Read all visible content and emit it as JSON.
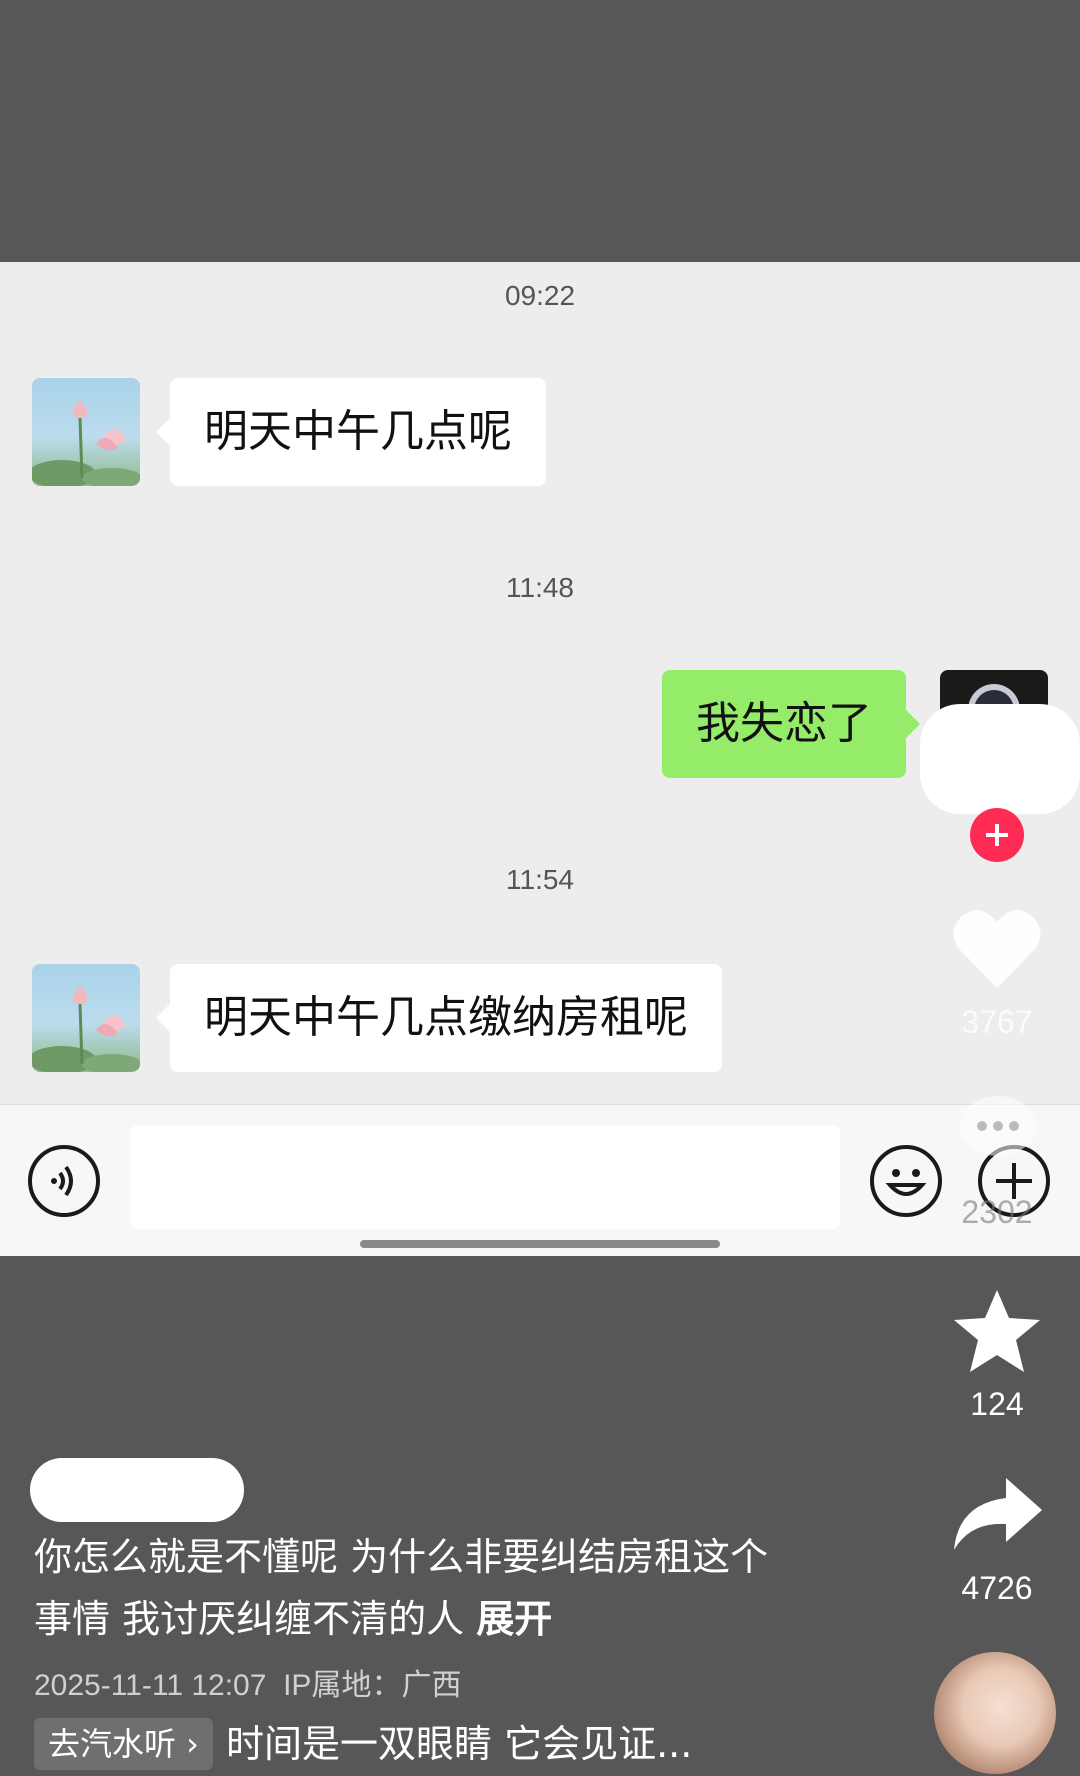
{
  "chat": {
    "timestamps": [
      "09:22",
      "11:48",
      "11:54"
    ],
    "messages": [
      {
        "side": "left",
        "text": "明天中午几点呢"
      },
      {
        "side": "right",
        "text": "我失恋了"
      },
      {
        "side": "left",
        "text": "明天中午几点缴纳房租呢"
      }
    ],
    "input_bar": {
      "voice_icon": "voice-icon",
      "emoji_icon": "emoji-icon",
      "add_icon": "plus-icon"
    }
  },
  "side_actions": {
    "like_count": "3767",
    "comment_count": "2302",
    "favorite_count": "124",
    "share_count": "4726"
  },
  "post": {
    "caption": "你怎么就是不懂呢 为什么非要纠结房租这个事情 我讨厌纠缠不清的人",
    "caption_line1": "你怎么就是不懂呢 为什么非要纠结房租这个",
    "caption_line2": "事情 我讨厌纠缠不清的人",
    "expand_label": "展开",
    "date": "2025-11-11 12:07",
    "ip_location": "IP属地：广西"
  },
  "music": {
    "tag_label": "去汽水听 ›",
    "title": "时间是一双眼睛 它会见证..."
  },
  "colors": {
    "chat_bg": "#ededed",
    "self_bubble": "#95ec69",
    "other_bubble": "#ffffff",
    "page_bg": "#575757",
    "follow_red": "#fe2c55"
  }
}
